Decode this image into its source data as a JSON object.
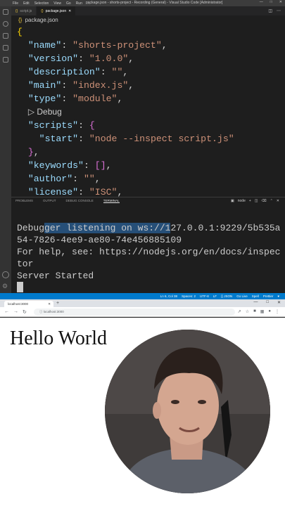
{
  "titlebar": {
    "menu": [
      "File",
      "Edit",
      "Selection",
      "View",
      "Go",
      "Run",
      "…"
    ],
    "title": "package.json - shorts-project - Recording (General) - Visual Studio Code [Administrator]"
  },
  "tabs": [
    {
      "label": "script.js",
      "icon": "{}"
    },
    {
      "label": "package.json",
      "icon": "{}"
    }
  ],
  "breadcrumb": {
    "icon": "{}",
    "label": "package.json"
  },
  "editor": {
    "open": "{",
    "lines": [
      {
        "key": "\"name\"",
        "value": "\"shorts-project\""
      },
      {
        "key": "\"version\"",
        "value": "\"1.0.0\""
      },
      {
        "key": "\"description\"",
        "value": "\"\""
      },
      {
        "key": "\"main\"",
        "value": "\"index.js\""
      },
      {
        "key": "\"type\"",
        "value": "\"module\""
      }
    ],
    "debug_lens": "▷ Debug",
    "scripts_key": "\"scripts\"",
    "start_key": "\"start\"",
    "start_value": "\"node --inspect script.js\"",
    "keywords_key": "\"keywords\"",
    "keywords_value": "[]",
    "author_key": "\"author\"",
    "author_value": "\"\"",
    "license_key": "\"license\"",
    "license_value": "\"ISC\""
  },
  "panel": {
    "tabs": [
      "PROBLEMS",
      "OUTPUT",
      "DEBUG CONSOLE",
      "TERMINAL"
    ],
    "active_tab": "TERMINAL",
    "shell": "node"
  },
  "terminal": {
    "line1_prefix": "Debug",
    "line1_selected": "ger listening on ws://1",
    "line1_rest": "27.0.0.1:9229/5b535a54-7826-4ee9-ae80-74e456885109",
    "line2": "For help, see: https://nodejs.org/en/docs/inspector",
    "line3": "Server Started"
  },
  "statusbar": [
    "Ln 6, Col 38",
    "Spaces: 2",
    "UTF-8",
    "LF",
    "{} JSON",
    "Go Live",
    "Spell",
    "Prettier"
  ],
  "browser": {
    "tab_title": "localhost:3000",
    "url": "localhost:3000",
    "page_heading": "Hello World"
  }
}
